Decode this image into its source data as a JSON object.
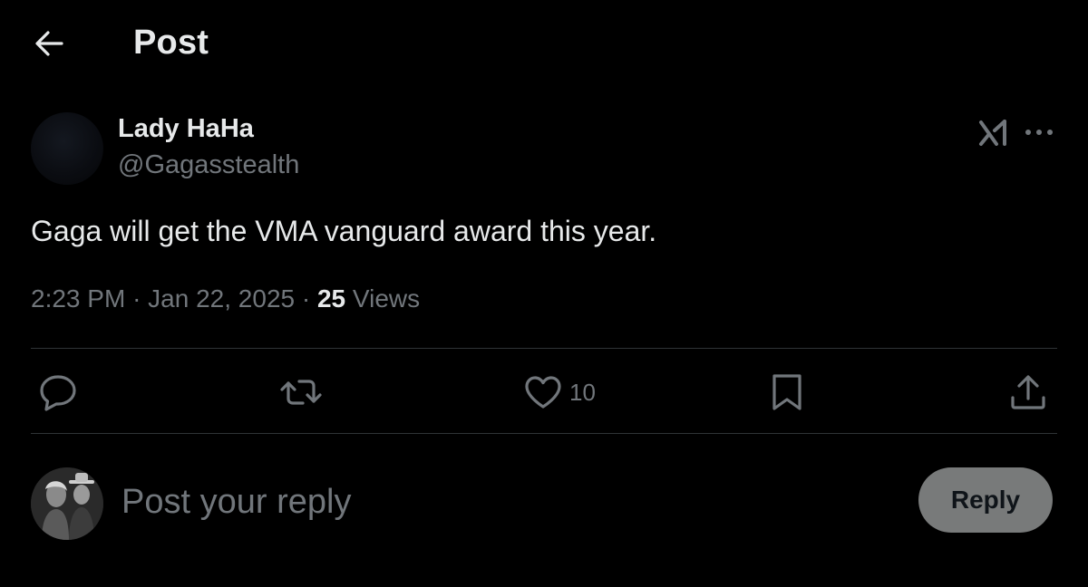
{
  "header": {
    "title": "Post",
    "back_icon": "arrow-left-icon"
  },
  "post": {
    "author_name": "Lady HaHa",
    "author_handle": "@Gagasstealth",
    "text": "Gaga will get the VMA vanguard award this year.",
    "time": "2:23 PM",
    "separator": "·",
    "date": "Jan 22, 2025",
    "views_count": "25",
    "views_label": "Views",
    "top_actions": [
      "grok-icon",
      "more-icon"
    ]
  },
  "actions": {
    "reply_icon": "reply-bubble-icon",
    "repost_icon": "repost-icon",
    "like_icon": "heart-icon",
    "like_count": "10",
    "bookmark_icon": "bookmark-icon",
    "share_icon": "share-icon"
  },
  "composer": {
    "placeholder": "Post your reply",
    "value": "",
    "reply_button_label": "Reply"
  },
  "colors": {
    "background": "#000000",
    "primary_text": "#e7e9ea",
    "secondary_text": "#71767b",
    "divider": "#2f3336",
    "reply_button_bg": "#787a7a"
  }
}
